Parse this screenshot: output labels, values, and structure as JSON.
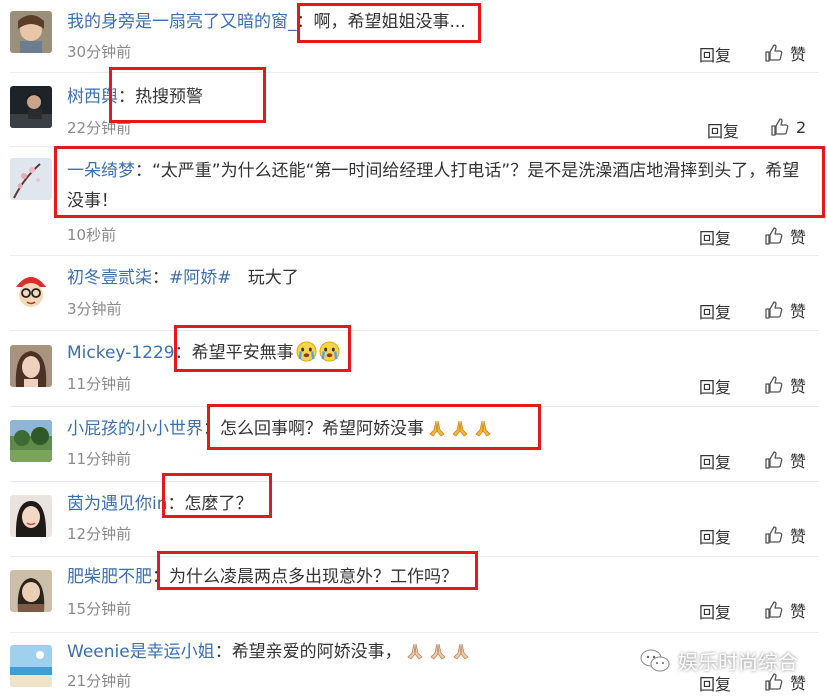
{
  "comments": [
    {
      "user": "我的身旁是一扇亮了又暗的窗_",
      "sep": "：",
      "text": "啊，希望姐姐没事...",
      "time": "30分钟前",
      "reply": "回复",
      "like": "赞"
    },
    {
      "user": "树西舆",
      "sep": "：",
      "text": "热搜预警",
      "time": "22分钟前",
      "reply": "回复",
      "like": "2"
    },
    {
      "user": "一朵绮梦",
      "sep": "：",
      "text": "“太严重”为什么还能“第一时间给经理人打电话”？是不是洗澡酒店地滑摔到头了，希望没事！",
      "time": "10秒前",
      "reply": "回复",
      "like": "赞"
    },
    {
      "user": "初冬壹贰柒",
      "sep": "：",
      "tag": "#阿娇#",
      "text": "玩大了",
      "time": "3分钟前",
      "reply": "回复",
      "like": "赞"
    },
    {
      "user": "Mickey-1229",
      "sep": "：",
      "text": "希望平安無事",
      "time": "11分钟前",
      "reply": "回复",
      "like": "赞"
    },
    {
      "user": "小屁孩的小小世界",
      "sep": "：",
      "text": "怎么回事啊？希望阿娇没事",
      "time": "11分钟前",
      "reply": "回复",
      "like": "赞"
    },
    {
      "user": "茵为遇见你in",
      "sep": "：",
      "text": "怎麼了？",
      "time": "12分钟前",
      "reply": "回复",
      "like": "赞"
    },
    {
      "user": "肥柴肥不肥",
      "sep": "：",
      "text": "为什么凌晨两点多出现意外？工作吗？",
      "time": "15分钟前",
      "reply": "回复",
      "like": "赞"
    },
    {
      "user": "Weenie是幸运小姐",
      "sep": "：",
      "text": "希望亲爱的阿娇没事，",
      "time": "21分钟前",
      "reply": "回复",
      "like": "赞"
    }
  ],
  "watermark": {
    "text": "娱乐时尚综合",
    "icon": "wechat-icon"
  },
  "colors": {
    "username": "#3a6fb0",
    "highlight_box": "#e41a1a",
    "time": "#8a8a8a"
  }
}
